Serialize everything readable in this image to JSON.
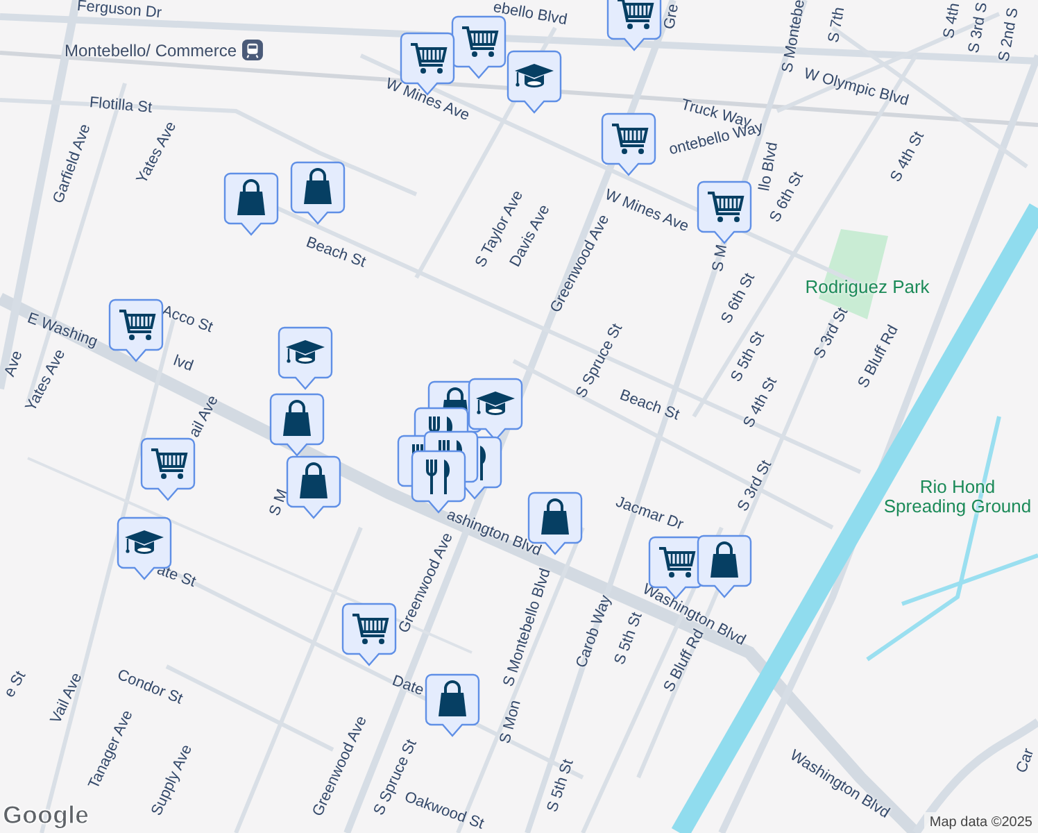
{
  "map": {
    "labels": [
      {
        "text": "Ferguson Dr",
        "kind": "street"
      },
      {
        "text": "Montebello/ Commerce",
        "kind": "transit"
      },
      {
        "text": "Flotilla St",
        "kind": "street"
      },
      {
        "text": "Garfield Ave",
        "kind": "street"
      },
      {
        "text": "Yates Ave",
        "kind": "street"
      },
      {
        "text": "W Mines Ave",
        "kind": "street"
      },
      {
        "text": "Beach St",
        "kind": "street"
      },
      {
        "text": "S Taylor Ave",
        "kind": "street"
      },
      {
        "text": "Davis Ave",
        "kind": "street"
      },
      {
        "text": "Greenwood Ave",
        "kind": "street"
      },
      {
        "text": "Acco St",
        "kind": "street"
      },
      {
        "text": "E Washing",
        "kind": "street"
      },
      {
        "text": "Yates Ave",
        "kind": "street"
      },
      {
        "text": "Ave",
        "kind": "street"
      },
      {
        "text": "ebello Blvd",
        "kind": "street"
      },
      {
        "text": "Gre",
        "kind": "street"
      },
      {
        "text": "S Montebe",
        "kind": "street"
      },
      {
        "text": "S 7th",
        "kind": "street"
      },
      {
        "text": "S 4th",
        "kind": "street"
      },
      {
        "text": "S 3rd S",
        "kind": "street"
      },
      {
        "text": "S 2nd S",
        "kind": "street"
      },
      {
        "text": "W Olympic Blvd",
        "kind": "street"
      },
      {
        "text": "Truck Way",
        "kind": "street"
      },
      {
        "text": "ontebello Way",
        "kind": "street"
      },
      {
        "text": "W Mines Ave",
        "kind": "street"
      },
      {
        "text": "llo Blvd",
        "kind": "street"
      },
      {
        "text": "S 6th St",
        "kind": "street"
      },
      {
        "text": "S 4th St",
        "kind": "street"
      },
      {
        "text": "Rodriguez Park",
        "kind": "park"
      },
      {
        "text": "S 6th St",
        "kind": "street"
      },
      {
        "text": "S 5th St",
        "kind": "street"
      },
      {
        "text": "S 3rd St",
        "kind": "street"
      },
      {
        "text": "S Bluff Rd",
        "kind": "street"
      },
      {
        "text": "S Spruce St",
        "kind": "street"
      },
      {
        "text": "Beach St",
        "kind": "street"
      },
      {
        "text": "S 4th St",
        "kind": "street"
      },
      {
        "text": "Jacmar Dr",
        "kind": "street"
      },
      {
        "text": "S 3rd St",
        "kind": "street"
      },
      {
        "text": "Rio Hond Spreading Ground",
        "kind": "park"
      },
      {
        "text": "ashington Blvd",
        "kind": "street"
      },
      {
        "text": "Washington Blvd",
        "kind": "street"
      },
      {
        "text": "S Montebello Blvd",
        "kind": "street"
      },
      {
        "text": "Carob Way",
        "kind": "street"
      },
      {
        "text": "S 5th St",
        "kind": "street"
      },
      {
        "text": "S Bluff Rd",
        "kind": "street"
      },
      {
        "text": "Washington Blvd",
        "kind": "street"
      },
      {
        "text": "S 5th St",
        "kind": "street"
      },
      {
        "text": "Car",
        "kind": "street"
      },
      {
        "text": "ail Ave",
        "kind": "street"
      },
      {
        "text": "S M",
        "kind": "street"
      },
      {
        "text": "ate St",
        "kind": "street"
      },
      {
        "text": "Condor St",
        "kind": "street"
      },
      {
        "text": "Vail Ave",
        "kind": "street"
      },
      {
        "text": "Tanager Ave",
        "kind": "street"
      },
      {
        "text": "Supply Ave",
        "kind": "street"
      },
      {
        "text": "Greenwood Ave",
        "kind": "street"
      },
      {
        "text": "Greenwood Ave",
        "kind": "street"
      },
      {
        "text": "Date",
        "kind": "street"
      },
      {
        "text": "S Spruce St",
        "kind": "street"
      },
      {
        "text": "Oakwood St",
        "kind": "street"
      },
      {
        "text": "S Mon",
        "kind": "street"
      },
      {
        "text": "e St",
        "kind": "street"
      },
      {
        "text": "lvd",
        "kind": "street"
      },
      {
        "text": "S M",
        "kind": "street"
      }
    ],
    "markers": [
      {
        "kind": "grocery"
      },
      {
        "kind": "grocery"
      },
      {
        "kind": "grocery"
      },
      {
        "kind": "school"
      },
      {
        "kind": "grocery"
      },
      {
        "kind": "grocery"
      },
      {
        "kind": "shopping"
      },
      {
        "kind": "shopping"
      },
      {
        "kind": "grocery"
      },
      {
        "kind": "school"
      },
      {
        "kind": "shopping"
      },
      {
        "kind": "shopping"
      },
      {
        "kind": "school"
      },
      {
        "kind": "restaurant"
      },
      {
        "kind": "restaurant"
      },
      {
        "kind": "restaurant"
      },
      {
        "kind": "restaurant"
      },
      {
        "kind": "restaurant"
      },
      {
        "kind": "grocery"
      },
      {
        "kind": "shopping"
      },
      {
        "kind": "school"
      },
      {
        "kind": "shopping"
      },
      {
        "kind": "grocery"
      },
      {
        "kind": "shopping"
      },
      {
        "kind": "grocery"
      },
      {
        "kind": "shopping"
      }
    ],
    "logo": "Google",
    "attribution": "Map data ©2025"
  }
}
